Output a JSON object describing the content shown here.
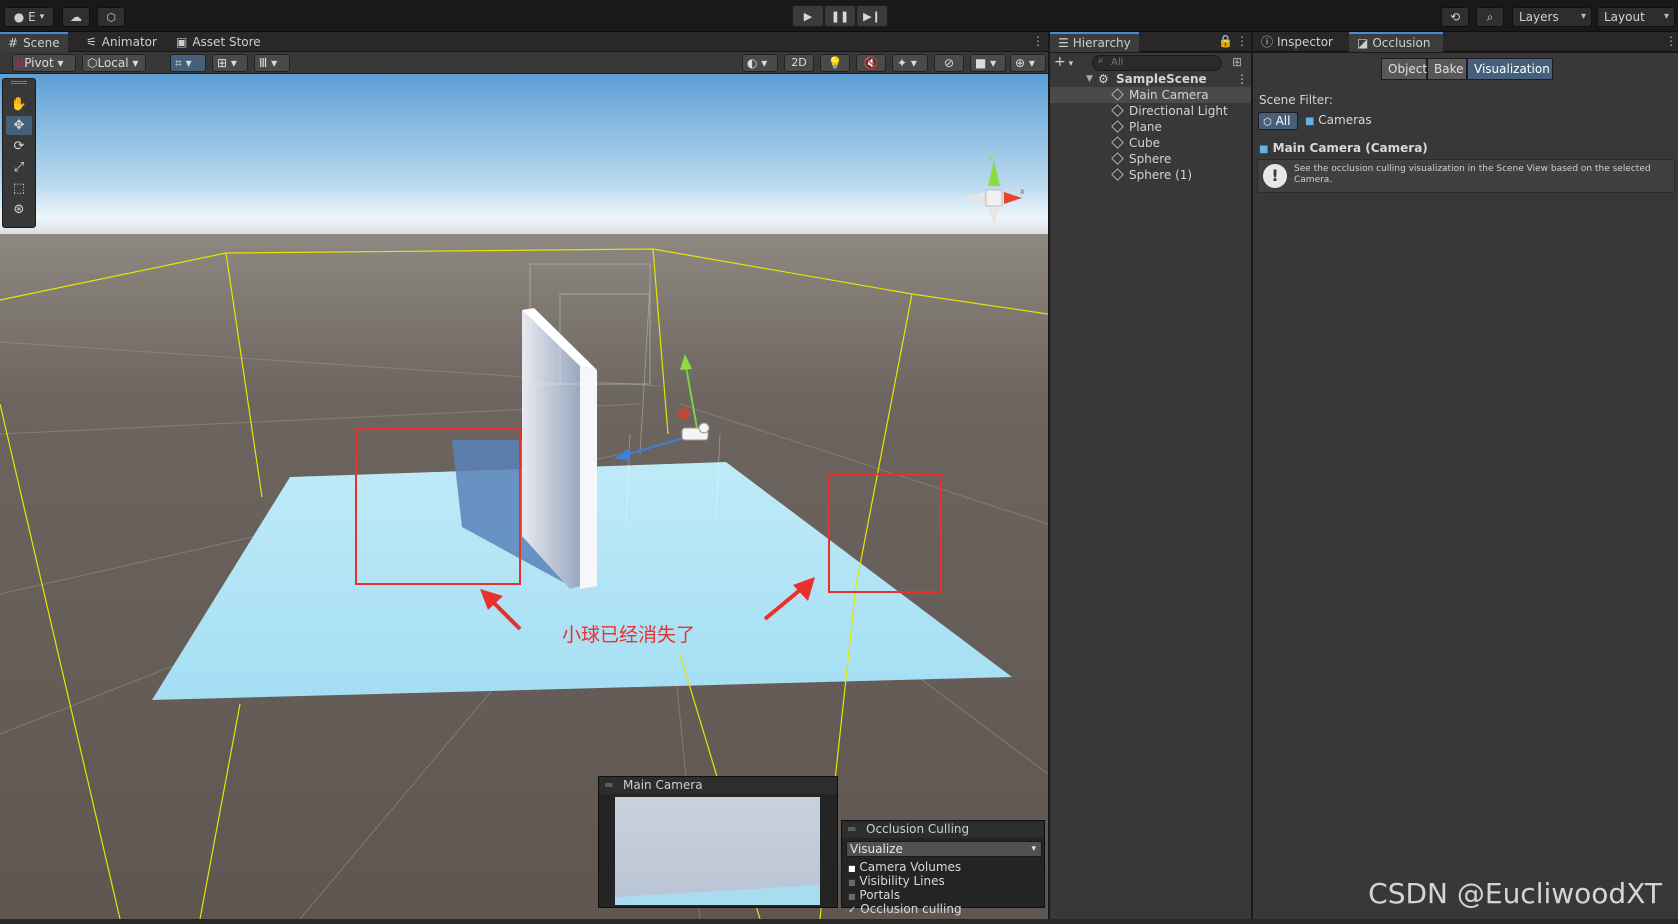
{
  "topbar": {
    "account_label": "E",
    "layers_label": "Layers",
    "layout_label": "Layout"
  },
  "scene_tabs": [
    {
      "label": "Scene",
      "icon": "grid-icon",
      "active": true
    },
    {
      "label": "Animator",
      "icon": "animator-icon",
      "active": false
    },
    {
      "label": "Asset Store",
      "icon": "store-bag-icon",
      "active": false
    }
  ],
  "scene_toolbar": {
    "pivot_label": "Pivot",
    "local_label": "Local",
    "mode_2d_label": "2D"
  },
  "hierarchy": {
    "tab_label": "Hierarchy",
    "search_placeholder": "All",
    "scene_name": "SampleScene",
    "items": [
      {
        "label": "Main Camera",
        "selected": true
      },
      {
        "label": "Directional Light",
        "selected": false
      },
      {
        "label": "Plane",
        "selected": false
      },
      {
        "label": "Cube",
        "selected": false
      },
      {
        "label": "Sphere",
        "selected": false
      },
      {
        "label": "Sphere (1)",
        "selected": false
      }
    ]
  },
  "inspector": {
    "tabs": [
      {
        "label": "Inspector",
        "icon": "info-icon",
        "active": false
      },
      {
        "label": "Occlusion",
        "icon": "occlusion-icon",
        "active": true
      }
    ],
    "modes": [
      {
        "label": "Object",
        "active": false
      },
      {
        "label": "Bake",
        "active": false
      },
      {
        "label": "Visualization",
        "active": true
      }
    ],
    "scene_filter_label": "Scene Filter:",
    "filter_all_label": "All",
    "filter_cameras_label": "Cameras",
    "camera_heading": "Main Camera (Camera)",
    "info_text": "See the occlusion culling visualization in the Scene View based on the selected Camera."
  },
  "camera_preview": {
    "title": "Main Camera"
  },
  "occlusion_overlay": {
    "title": "Occlusion Culling",
    "mode_value": "Visualize",
    "options": [
      {
        "label": "Camera Volumes",
        "checked": true
      },
      {
        "label": "Visibility Lines",
        "checked": false
      },
      {
        "label": "Portals",
        "checked": false
      },
      {
        "label": "Occlusion culling",
        "checked": true
      }
    ]
  },
  "annotation": {
    "text": "小球已经消失了",
    "color": "#e8302c"
  },
  "watermark": "CSDN @EucliwoodXT",
  "colors": {
    "accent": "#4a8ad4",
    "selection": "#46607c",
    "plane": "#a8dcf0",
    "volume_lines": "#e6e600"
  }
}
